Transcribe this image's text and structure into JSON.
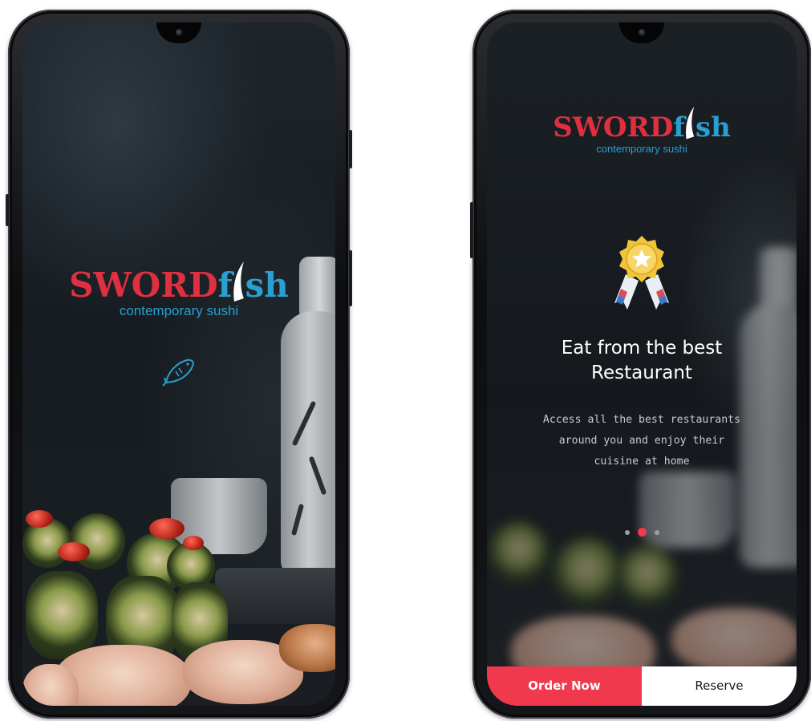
{
  "splash": {
    "logo_part1": "SWORD",
    "logo_part2": "f",
    "logo_part3": "sh",
    "tagline": "contemporary sushi"
  },
  "onboarding": {
    "logo_part1": "SWORD",
    "logo_part2": "f",
    "logo_part3": "sh",
    "tagline": "contemporary sushi",
    "headline_line1": "Eat from the best",
    "headline_line2": "Restaurant",
    "description_line1": "Access all the best restaurants",
    "description_line2": "around you and enjoy their",
    "description_line3": "cuisine at home",
    "page_indicator": {
      "total": 3,
      "active": 2
    },
    "order_button": "Order Now",
    "reserve_button": "Reserve"
  },
  "colors": {
    "brand_red": "#e0303f",
    "brand_blue": "#2a9fd0",
    "accent": "#f0394d"
  },
  "icons": {
    "splash": "fish-icon",
    "onboarding": "award-medal-icon"
  }
}
